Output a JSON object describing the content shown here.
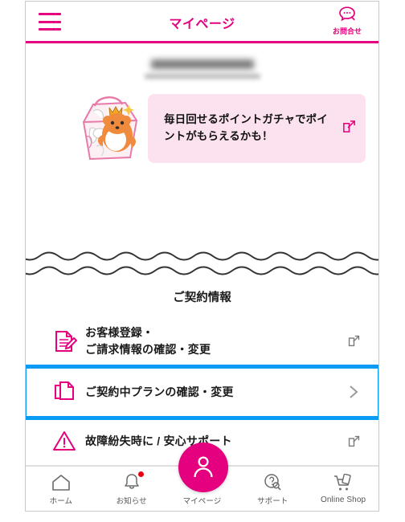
{
  "header": {
    "menu_icon": "hamburger-menu-icon",
    "title": "マイページ",
    "contact_icon": "chat-bubble-icon",
    "contact_label": "お問合せ"
  },
  "account": {
    "name_redacted": true,
    "id_redacted": true
  },
  "banner": {
    "illustration": "hamster-treasure-basket-illustration",
    "text": "毎日回せるポイントガチャでポイントがもらえるかも！",
    "action_icon": "external-link-icon"
  },
  "divider": {
    "style": "wavy-double-line"
  },
  "section": {
    "title": "ご契約情報",
    "items": [
      {
        "icon": "document-pen-icon",
        "label_line1": "お客様登録・",
        "label_line2": "ご請求情報の確認・変更",
        "action_icon": "external-link-icon",
        "selected": false
      },
      {
        "icon": "copy-documents-icon",
        "label_line1": "ご契約中プランの確認・変更",
        "label_line2": "",
        "action_icon": "chevron-right-icon",
        "selected": true
      },
      {
        "icon": "warning-triangle-icon",
        "label_line1": "故障紛失時に / 安心サポート",
        "label_line2": "",
        "action_icon": "external-link-icon",
        "selected": false
      }
    ]
  },
  "bottom_nav": {
    "items": [
      {
        "icon": "home-icon",
        "label": "ホーム",
        "badge": false,
        "active": false
      },
      {
        "icon": "bell-icon",
        "label": "お知らせ",
        "badge": true,
        "active": false
      },
      {
        "icon": "person-icon",
        "label": "マイページ",
        "badge": false,
        "active": true
      },
      {
        "icon": "support-question-icon",
        "label": "サポート",
        "badge": false,
        "active": false
      },
      {
        "icon": "shopping-cart-icon",
        "label": "Online Shop",
        "badge": false,
        "active": false
      }
    ]
  },
  "colors": {
    "brand_pink": "#e4007f",
    "banner_bg": "#fbe2ee",
    "selection_blue": "#0a9cf5",
    "badge_red": "#e60012",
    "nav_gray": "#555555"
  }
}
